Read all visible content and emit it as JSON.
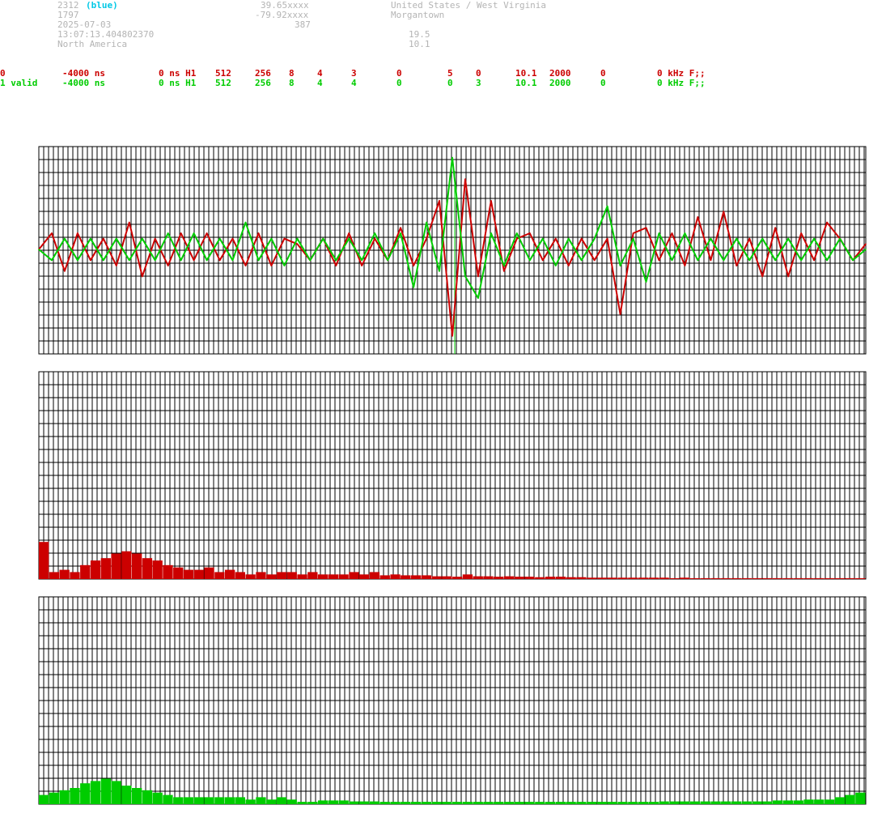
{
  "header": {
    "station_id": "2312",
    "color_tag": "(blue)",
    "latitude": "39.65xxxx",
    "location": "United States / West Virginia",
    "number": "1797",
    "longitude": "-79.92xxxx",
    "city": "Morgantown",
    "date": "2025-07-03",
    "altitude": "387",
    "time": "13:07:13.404802370",
    "value_a": "19.5",
    "region": "North America",
    "value_b": "10.1"
  },
  "rows": [
    {
      "label": "0",
      "c1": "-4000 ns",
      "c2": "0 ns H1",
      "c3": "512",
      "c4": "256",
      "c5": "8",
      "c6": "4",
      "c7": "3",
      "c8": "0",
      "c9": "5",
      "c10": "0",
      "c11": "10.1",
      "c12": "2000",
      "c13": "0",
      "c14": "0 kHz F;;"
    },
    {
      "label": "1 valid",
      "c1": "-4000 ns",
      "c2": "0 ns H1",
      "c3": "512",
      "c4": "256",
      "c5": "8",
      "c6": "4",
      "c7": "4",
      "c8": "0",
      "c9": "0",
      "c10": "3",
      "c11": "10.1",
      "c12": "2000",
      "c13": "0",
      "c14": "0 kHz F;;"
    }
  ],
  "colors": {
    "channel_0": "#cc0000",
    "channel_1": "#00cc00",
    "grid": "#000000",
    "header_grey": "#b4b4b4",
    "tag": "#00c8e6"
  },
  "chart_data": [
    {
      "type": "line",
      "grid": true,
      "marker_x": 256,
      "x": [
        0,
        8,
        16,
        24,
        32,
        40,
        48,
        56,
        64,
        72,
        80,
        88,
        96,
        104,
        112,
        120,
        128,
        136,
        144,
        152,
        160,
        168,
        176,
        184,
        192,
        200,
        208,
        216,
        224,
        232,
        240,
        248,
        256,
        264,
        272,
        280,
        288,
        296,
        304,
        312,
        320,
        328,
        336,
        344,
        352,
        360,
        368,
        376,
        384,
        392,
        400,
        408,
        416,
        424,
        432,
        440,
        448,
        456,
        464,
        472,
        480,
        488,
        496,
        504,
        512
      ],
      "series": [
        {
          "values": [
            0,
            0.3,
            -0.4,
            0.3,
            -0.2,
            0.2,
            -0.3,
            0.5,
            -0.5,
            0.2,
            -0.3,
            0.3,
            -0.2,
            0.3,
            -0.2,
            0.2,
            -0.3,
            0.3,
            -0.3,
            0.2,
            0.1,
            -0.2,
            0.2,
            -0.3,
            0.3,
            -0.3,
            0.2,
            -0.2,
            0.4,
            -0.3,
            0.2,
            0.9,
            -1.6,
            1.3,
            -0.5,
            0.9,
            -0.4,
            0.2,
            0.3,
            -0.2,
            0.2,
            -0.3,
            0.2,
            -0.2,
            0.2,
            -1.2,
            0.3,
            0.4,
            -0.2,
            0.3,
            -0.3,
            0.6,
            -0.2,
            0.7,
            -0.3,
            0.2,
            -0.5,
            0.4,
            -0.5,
            0.3,
            -0.2,
            0.5,
            0.2,
            -0.2,
            0.1
          ]
        },
        {
          "values": [
            0,
            -0.2,
            0.2,
            -0.2,
            0.2,
            -0.2,
            0.2,
            -0.2,
            0.2,
            -0.2,
            0.3,
            -0.2,
            0.3,
            -0.2,
            0.2,
            -0.2,
            0.5,
            -0.2,
            0.2,
            -0.3,
            0.2,
            -0.2,
            0.2,
            -0.2,
            0.2,
            -0.2,
            0.3,
            -0.2,
            0.3,
            -0.7,
            0.5,
            -0.4,
            1.7,
            -0.5,
            -0.9,
            0.3,
            -0.3,
            0.3,
            -0.2,
            0.2,
            -0.3,
            0.2,
            -0.2,
            0.2,
            0.8,
            -0.3,
            0.2,
            -0.6,
            0.3,
            -0.2,
            0.3,
            -0.2,
            0.2,
            -0.2,
            0.2,
            -0.2,
            0.2,
            -0.2,
            0.2,
            -0.2,
            0.2,
            -0.2,
            0.2,
            -0.2,
            0
          ]
        }
      ]
    },
    {
      "type": "bar",
      "grid": true,
      "series": [
        {
          "values": [
            8,
            1.5,
            2,
            1.5,
            3,
            4,
            4.5,
            5.5,
            6,
            5.5,
            4.5,
            4,
            3,
            2.5,
            2,
            2,
            2.5,
            1.5,
            2,
            1.5,
            1,
            1.5,
            1,
            1.5,
            1.5,
            1,
            1.5,
            1,
            1,
            1,
            1.5,
            1,
            1.5,
            0.8,
            1,
            0.8,
            0.8,
            0.8,
            0.6,
            0.6,
            0.5,
            1,
            0.6,
            0.6,
            0.5,
            0.6,
            0.5,
            0.5,
            0.4,
            0.5,
            0.5,
            0.4,
            0.4,
            0.3,
            0.3,
            0.3,
            0.3,
            0.3,
            0.3,
            0.3,
            0.3,
            0.2,
            0.3,
            0.2,
            0.2,
            0.2,
            0.2,
            0.2,
            0.2,
            0.2,
            0.2,
            0.2,
            0.2,
            0.2,
            0.2,
            0.2,
            0.2,
            0.2,
            0.2,
            0.2
          ]
        }
      ]
    },
    {
      "type": "bar",
      "grid": true,
      "series": [
        {
          "values": [
            2,
            2.5,
            3,
            3.5,
            4.5,
            5,
            5.5,
            5,
            4,
            3.5,
            3,
            2.5,
            2,
            1.5,
            1.5,
            1.5,
            1.5,
            1.5,
            1.5,
            1.5,
            1,
            1.5,
            1,
            1.5,
            1,
            0.5,
            0.5,
            0.8,
            0.8,
            0.8,
            0.6,
            0.6,
            0.6,
            0.5,
            0.5,
            0.5,
            0.5,
            0.5,
            0.5,
            0.5,
            0.5,
            0.5,
            0.5,
            0.5,
            0.5,
            0.5,
            0.5,
            0.5,
            0.5,
            0.5,
            0.5,
            0.5,
            0.5,
            0.5,
            0.5,
            0.5,
            0.5,
            0.5,
            0.5,
            0.5,
            0.6,
            0.6,
            0.6,
            0.6,
            0.6,
            0.6,
            0.6,
            0.6,
            0.6,
            0.6,
            0.6,
            0.8,
            0.8,
            0.8,
            1,
            1,
            1,
            1.5,
            2,
            2.5
          ]
        }
      ]
    }
  ]
}
